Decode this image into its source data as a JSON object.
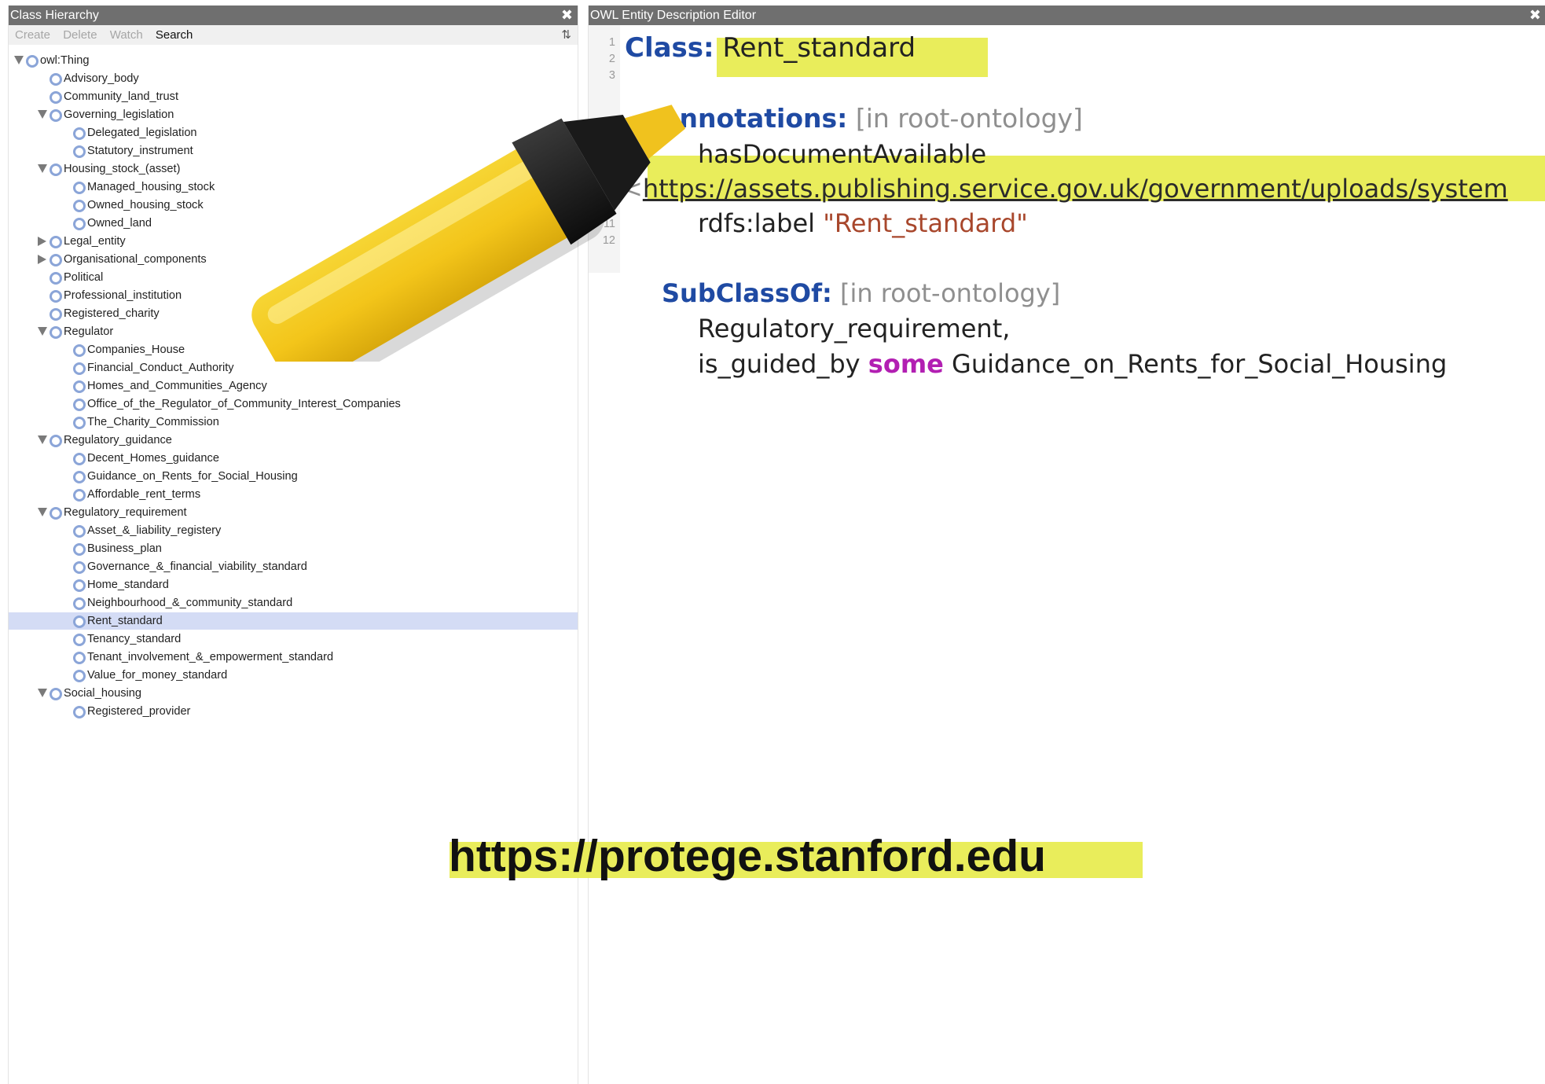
{
  "left_panel": {
    "title": "Class Hierarchy",
    "close_glyph": "✖",
    "toolbar": {
      "create": "Create",
      "delete": "Delete",
      "watch": "Watch",
      "search": "Search",
      "filter_icon_glyph": "⇅"
    },
    "tree": [
      {
        "label": "owl:Thing",
        "depth": 0,
        "expand": "open"
      },
      {
        "label": "Advisory_body",
        "depth": 1,
        "expand": "none"
      },
      {
        "label": "Community_land_trust",
        "depth": 1,
        "expand": "none"
      },
      {
        "label": "Governing_legislation",
        "depth": 1,
        "expand": "open"
      },
      {
        "label": "Delegated_legislation",
        "depth": 2,
        "expand": "none"
      },
      {
        "label": "Statutory_instrument",
        "depth": 2,
        "expand": "none"
      },
      {
        "label": "Housing_stock_(asset)",
        "depth": 1,
        "expand": "open"
      },
      {
        "label": "Managed_housing_stock",
        "depth": 2,
        "expand": "none"
      },
      {
        "label": "Owned_housing_stock",
        "depth": 2,
        "expand": "none"
      },
      {
        "label": "Owned_land",
        "depth": 2,
        "expand": "none"
      },
      {
        "label": "Legal_entity",
        "depth": 1,
        "expand": "closed"
      },
      {
        "label": "Organisational_components",
        "depth": 1,
        "expand": "closed"
      },
      {
        "label": "Political",
        "depth": 1,
        "expand": "none"
      },
      {
        "label": "Professional_institution",
        "depth": 1,
        "expand": "none"
      },
      {
        "label": "Registered_charity",
        "depth": 1,
        "expand": "none"
      },
      {
        "label": "Regulator",
        "depth": 1,
        "expand": "open"
      },
      {
        "label": "Companies_House",
        "depth": 2,
        "expand": "none"
      },
      {
        "label": "Financial_Conduct_Authority",
        "depth": 2,
        "expand": "none"
      },
      {
        "label": "Homes_and_Communities_Agency",
        "depth": 2,
        "expand": "none"
      },
      {
        "label": "Office_of_the_Regulator_of_Community_Interest_Companies",
        "depth": 2,
        "expand": "none"
      },
      {
        "label": "The_Charity_Commission",
        "depth": 2,
        "expand": "none"
      },
      {
        "label": "Regulatory_guidance",
        "depth": 1,
        "expand": "open"
      },
      {
        "label": "Decent_Homes_guidance",
        "depth": 2,
        "expand": "none"
      },
      {
        "label": "Guidance_on_Rents_for_Social_Housing",
        "depth": 2,
        "expand": "none"
      },
      {
        "label": "Affordable_rent_terms",
        "depth": 2,
        "expand": "none"
      },
      {
        "label": "Regulatory_requirement",
        "depth": 1,
        "expand": "open"
      },
      {
        "label": "Asset_&_liability_registery",
        "depth": 2,
        "expand": "none"
      },
      {
        "label": "Business_plan",
        "depth": 2,
        "expand": "none"
      },
      {
        "label": "Governance_&_financial_viability_standard",
        "depth": 2,
        "expand": "none"
      },
      {
        "label": "Home_standard",
        "depth": 2,
        "expand": "none"
      },
      {
        "label": "Neighbourhood_&_community_standard",
        "depth": 2,
        "expand": "none"
      },
      {
        "label": "Rent_standard",
        "depth": 2,
        "expand": "none",
        "selected": true
      },
      {
        "label": "Tenancy_standard",
        "depth": 2,
        "expand": "none"
      },
      {
        "label": "Tenant_involvement_&_empowerment_standard",
        "depth": 2,
        "expand": "none"
      },
      {
        "label": "Value_for_money_standard",
        "depth": 2,
        "expand": "none"
      },
      {
        "label": "Social_housing",
        "depth": 1,
        "expand": "open"
      },
      {
        "label": "Registered_provider",
        "depth": 2,
        "expand": "none"
      }
    ]
  },
  "right_panel": {
    "title": "OWL Entity Description Editor",
    "close_glyph": "✖",
    "line_numbers": [
      "1",
      "2",
      "3",
      "10",
      "11",
      "12"
    ],
    "class_keyword": "Class:",
    "class_name": "Rent_standard",
    "annotations_keyword": "Annotations:",
    "annotations_context": "[in root-ontology]",
    "annotation_property": "hasDocumentAvailable",
    "annotation_url_open": "<",
    "annotation_url": "https://assets.publishing.service.gov.uk/government/uploads/system",
    "label_property": "rdfs:label",
    "label_value": "\"Rent_standard\"",
    "subclassof_keyword": "SubClassOf:",
    "subclassof_context": "[in root-ontology]",
    "superclass_1": "Regulatory_requirement,",
    "restriction_property": "is_guided_by",
    "restriction_keyword": "some",
    "restriction_filler": "Guidance_on_Rents_for_Social_Housing"
  },
  "footer_url": "https://protege.stanford.edu",
  "colors": {
    "titlebar": "#6f6f6f",
    "keyword_blue": "#1f4aa3",
    "keyword_purple": "#b21fb2",
    "string_red": "#a8472c",
    "highlight_yellow": "#e8ec52",
    "selection": "#d4dcf5",
    "class_icon": "#8ba5d8"
  },
  "icons": {
    "expand_open": "triangle-down-icon",
    "expand_closed": "triangle-right-icon",
    "class_node": "class-circle-icon",
    "close": "close-icon",
    "filter": "filter-icon",
    "marker": "highlighter-marker-icon"
  }
}
